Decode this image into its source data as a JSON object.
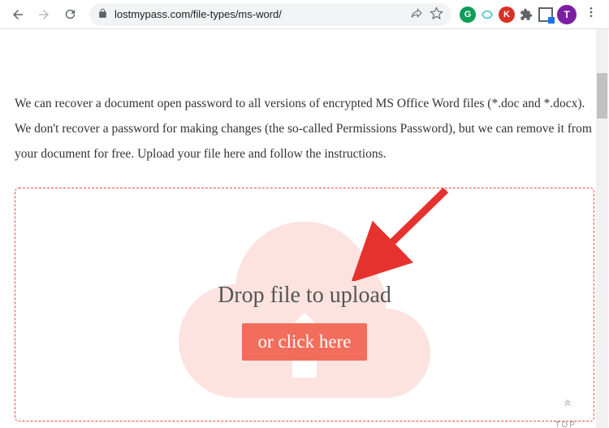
{
  "browser": {
    "url": "lostmypass.com/file-types/ms-word/",
    "avatar_letter": "T"
  },
  "page": {
    "description": "We can recover a document open password to all versions of encrypted MS Office Word files (*.doc and *.docx). We don't recover a password for making changes (the so-called Permissions Password), but we can remove it from your document for free. Upload your file here and follow the instructions.",
    "drop_label": "Drop file to upload",
    "click_button": "or click here",
    "top_label": "TOP"
  }
}
